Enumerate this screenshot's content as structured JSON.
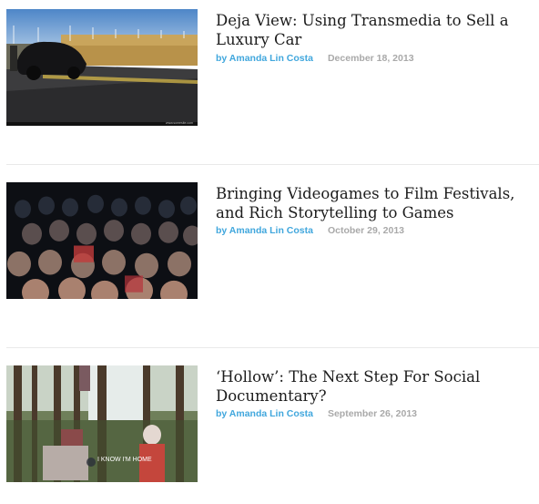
{
  "articles": [
    {
      "title": "Deja View: Using Transmedia to Sell a Luxury Car",
      "author": "by Amanda Lin Costa",
      "date": "December 18, 2013",
      "image_watermark": "www.somesite.com"
    },
    {
      "title": "Bringing Videogames to Film Festivals, and Rich Storytelling to Games",
      "author": "by Amanda Lin Costa",
      "date": "October 29, 2013"
    },
    {
      "title": "‘Hollow’: The Next Step For Social Documentary?",
      "author": "by Amanda Lin Costa",
      "date": "September 26, 2013",
      "image_caption": "I KNOW I'M HOME"
    }
  ],
  "colors": {
    "author_link": "#41a7dd",
    "date_text": "#a9a9a9",
    "title_text": "#1c1c1c",
    "divider": "#e9e9e9"
  }
}
